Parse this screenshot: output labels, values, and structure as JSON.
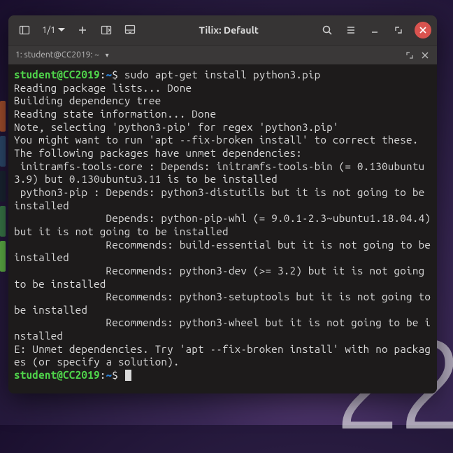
{
  "window": {
    "title": "Tilix: Default",
    "counter": "1/1"
  },
  "tab": {
    "label": "1: student@CC2019: ~",
    "dropdown_glyph": "▾"
  },
  "prompt": {
    "user_host": "student@CC2019",
    "sep": ":",
    "path": "~",
    "sigil": "$"
  },
  "command": "sudo apt-get install python3.pip",
  "output": {
    "l1": "Reading package lists... Done",
    "l2": "Building dependency tree",
    "l3": "Reading state information... Done",
    "l4": "Note, selecting 'python3-pip' for regex 'python3.pip'",
    "l5": "You might want to run 'apt --fix-broken install' to correct these.",
    "l6": "The following packages have unmet dependencies:",
    "l7": " initramfs-tools-core : Depends: initramfs-tools-bin (= 0.130ubuntu3.9) but 0.130ubuntu3.11 is to be installed",
    "l8": " python3-pip : Depends: python3-distutils but it is not going to be installed",
    "l9": "               Depends: python-pip-whl (= 9.0.1-2.3~ubuntu1.18.04.4) but it is not going to be installed",
    "l10": "               Recommends: build-essential but it is not going to be installed",
    "l11": "               Recommends: python3-dev (>= 3.2) but it is not going to be installed",
    "l12": "               Recommends: python3-setuptools but it is not going to be installed",
    "l13": "               Recommends: python3-wheel but it is not going to be installed",
    "l14": "E: Unmet dependencies. Try 'apt --fix-broken install' with no packages (or specify a solution)."
  },
  "bg_clock": "22"
}
